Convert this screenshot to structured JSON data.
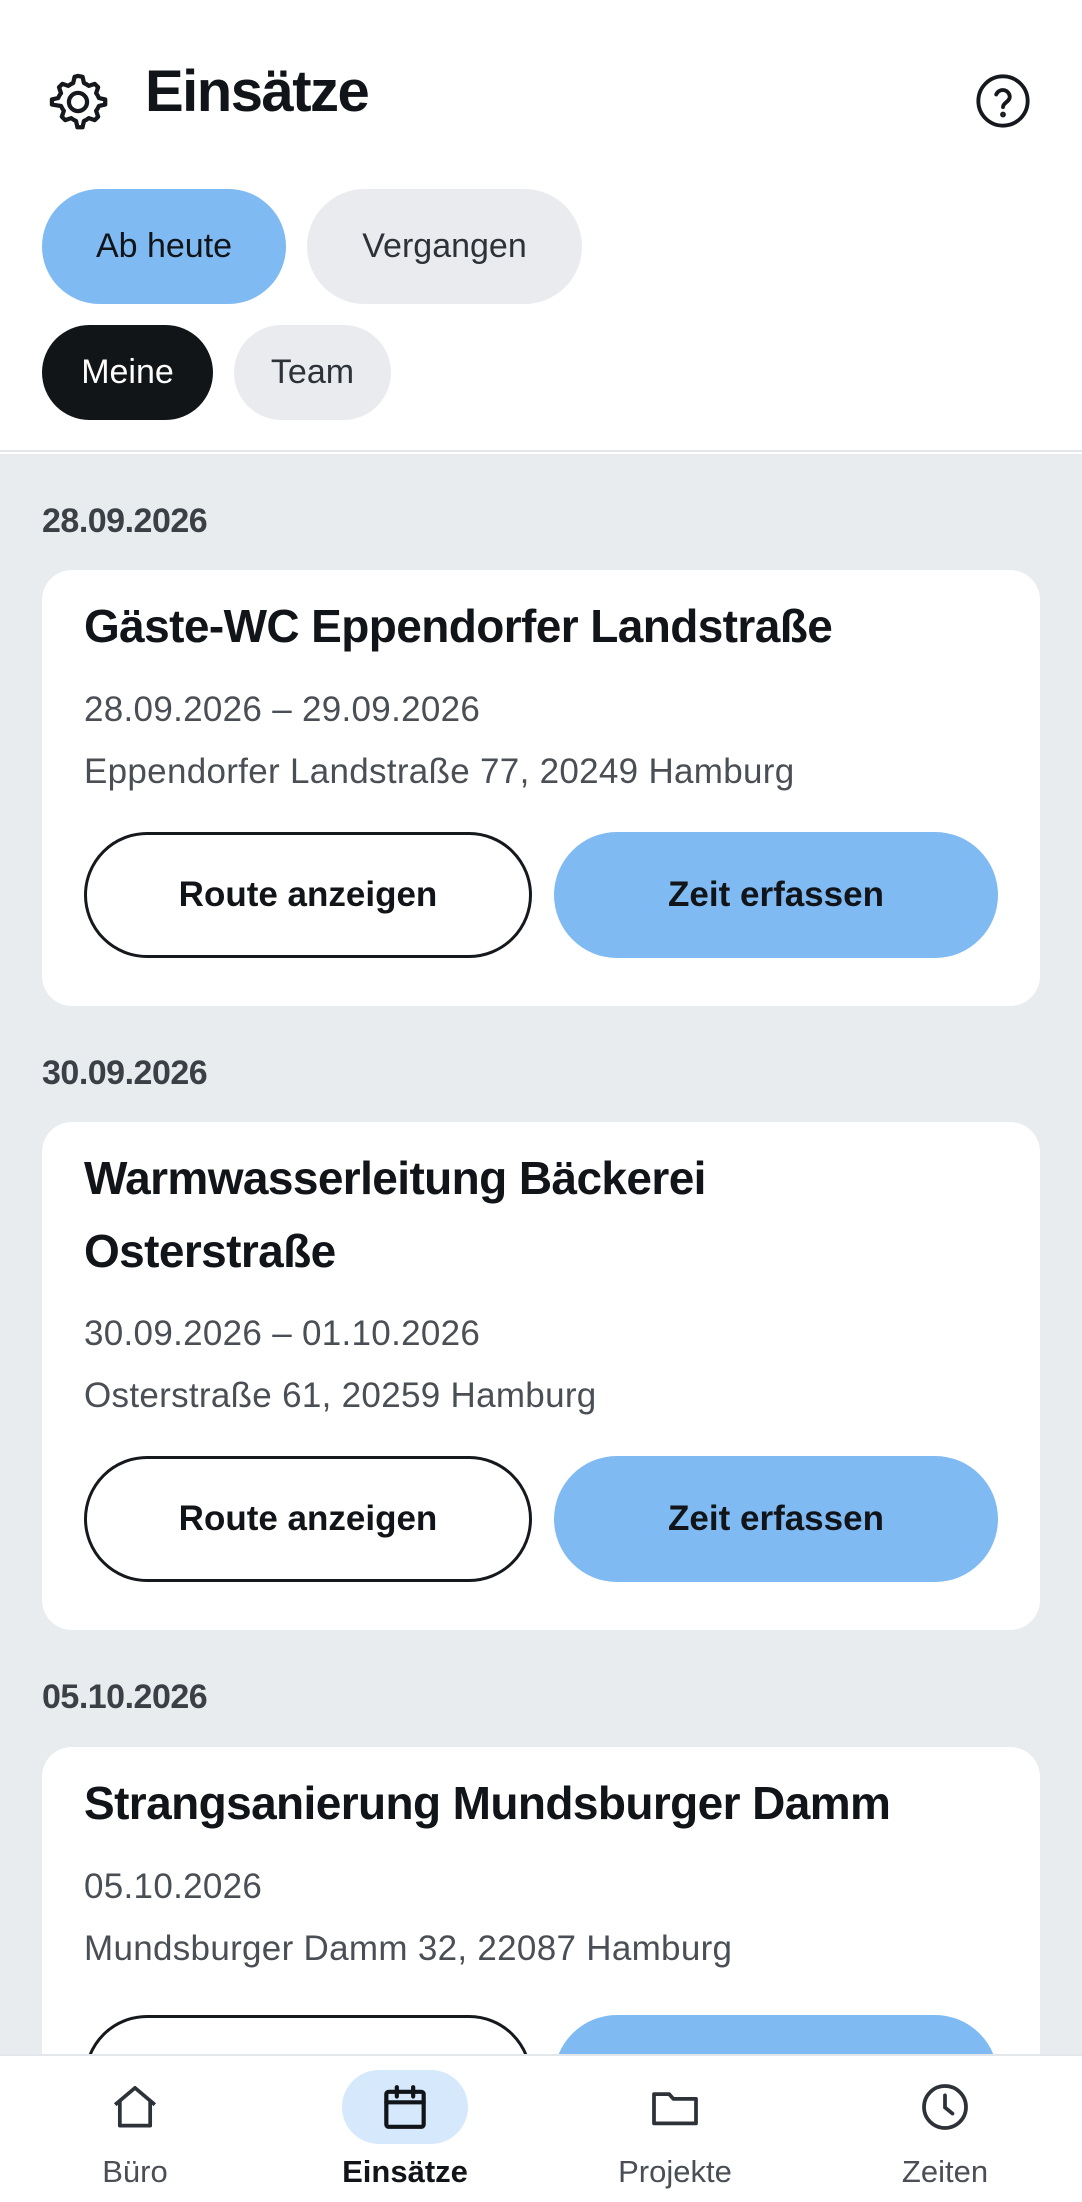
{
  "header": {
    "title": "Einsätze"
  },
  "filters": {
    "time": [
      {
        "label": "Ab heute",
        "selected": true
      },
      {
        "label": "Vergangen",
        "selected": false
      }
    ],
    "scope": [
      {
        "label": "Meine",
        "selected": true
      },
      {
        "label": "Team",
        "selected": false
      }
    ]
  },
  "groups": [
    {
      "date": "28.09.2026",
      "jobs": [
        {
          "title": "Gäste-WC Eppendorfer Landstraße",
          "dates": "28.09.2026 – 29.09.2026",
          "address": "Eppendorfer Landstraße 77, 20249 Hamburg",
          "route_label": "Route anzeigen",
          "time_label": "Zeit erfassen"
        }
      ]
    },
    {
      "date": "30.09.2026",
      "jobs": [
        {
          "title_line1": "Warmwasserleitung Bäckerei",
          "title_line2": "Osterstraße",
          "dates": "30.09.2026 – 01.10.2026",
          "address": "Osterstraße 61, 20259 Hamburg",
          "route_label": "Route anzeigen",
          "time_label": "Zeit erfassen"
        }
      ]
    },
    {
      "date": "05.10.2026",
      "jobs": [
        {
          "title": "Strangsanierung Mundsburger Damm",
          "dates": "05.10.2026",
          "address": "Mundsburger Damm 32, 22087 Hamburg"
        }
      ]
    }
  ],
  "bottom_nav": [
    {
      "label": "Büro",
      "icon": "home-icon",
      "active": false
    },
    {
      "label": "Einsätze",
      "icon": "calendar-icon",
      "active": true
    },
    {
      "label": "Projekte",
      "icon": "folder-icon",
      "active": false
    },
    {
      "label": "Zeiten",
      "icon": "clock-icon",
      "active": false
    }
  ],
  "colors": {
    "accent": "#7fbaf2",
    "accent_light": "#d6e8fb",
    "dark_chip": "#121518",
    "list_background": "#e9ecef"
  }
}
